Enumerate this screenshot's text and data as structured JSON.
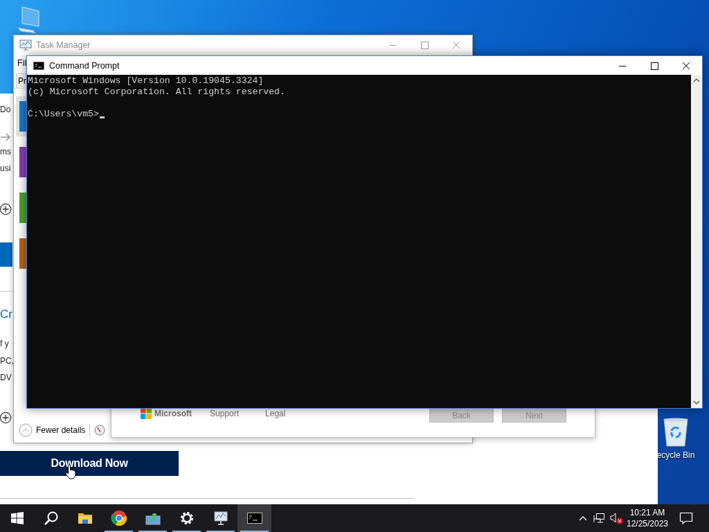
{
  "desktop": {
    "icons": [
      {
        "kind": "computer"
      },
      {
        "kind": "recycle-bin",
        "label": "ecycle Bin"
      }
    ]
  },
  "browser_page": {
    "fragments": [
      {
        "kind": "text",
        "text": "Do"
      },
      {
        "kind": "arrow"
      },
      {
        "kind": "text",
        "text": "ms"
      },
      {
        "kind": "text",
        "text": "usi"
      },
      {
        "kind": "expander"
      },
      {
        "kind": "bar"
      },
      {
        "kind": "heading",
        "text": "Cr"
      },
      {
        "kind": "text",
        "text": "f y"
      },
      {
        "kind": "text",
        "text": "PC,"
      },
      {
        "kind": "text",
        "text": "DV"
      },
      {
        "kind": "expander"
      }
    ],
    "download_button": "Download Now"
  },
  "task_manager": {
    "title": "Task Manager",
    "active": false,
    "menu": [
      "Fil"
    ],
    "tabs": [
      {
        "label": "Pr",
        "selected": true
      }
    ],
    "graphs": [
      {
        "color": "#1979ca",
        "selected": true
      },
      {
        "color": "#8e3bb5",
        "selected": false
      },
      {
        "color": "#4da52b",
        "selected": false
      },
      {
        "color": "#b8661a",
        "selected": false
      }
    ],
    "fewer_details": "Fewer details"
  },
  "setup_dialog": {
    "footer_links": [
      "Microsoft",
      "Support",
      "Legal"
    ],
    "buttons": [
      {
        "label": "Back",
        "disabled": true
      },
      {
        "label": "Next",
        "disabled": true
      }
    ]
  },
  "command_prompt": {
    "title": "Command Prompt",
    "lines": [
      "Microsoft Windows [Version 10.0.19045.3324]",
      "(c) Microsoft Corporation. All rights reserved."
    ],
    "prompt": "C:\\Users\\vm5>"
  },
  "taskbar": {
    "apps": [
      {
        "kind": "start",
        "running": false,
        "active": false
      },
      {
        "kind": "search",
        "running": false,
        "active": false
      },
      {
        "kind": "folder",
        "running": false,
        "active": false
      },
      {
        "kind": "browser",
        "running": true,
        "active": false
      },
      {
        "kind": "monitor-arrow",
        "running": true,
        "active": false
      },
      {
        "kind": "settings",
        "running": true,
        "active": false
      },
      {
        "kind": "monitor-graph",
        "running": true,
        "active": false
      },
      {
        "kind": "terminal",
        "running": true,
        "active": true
      }
    ],
    "tray": {
      "volume_muted": true,
      "time": "10:21 AM",
      "date": "12/25/2023"
    }
  }
}
